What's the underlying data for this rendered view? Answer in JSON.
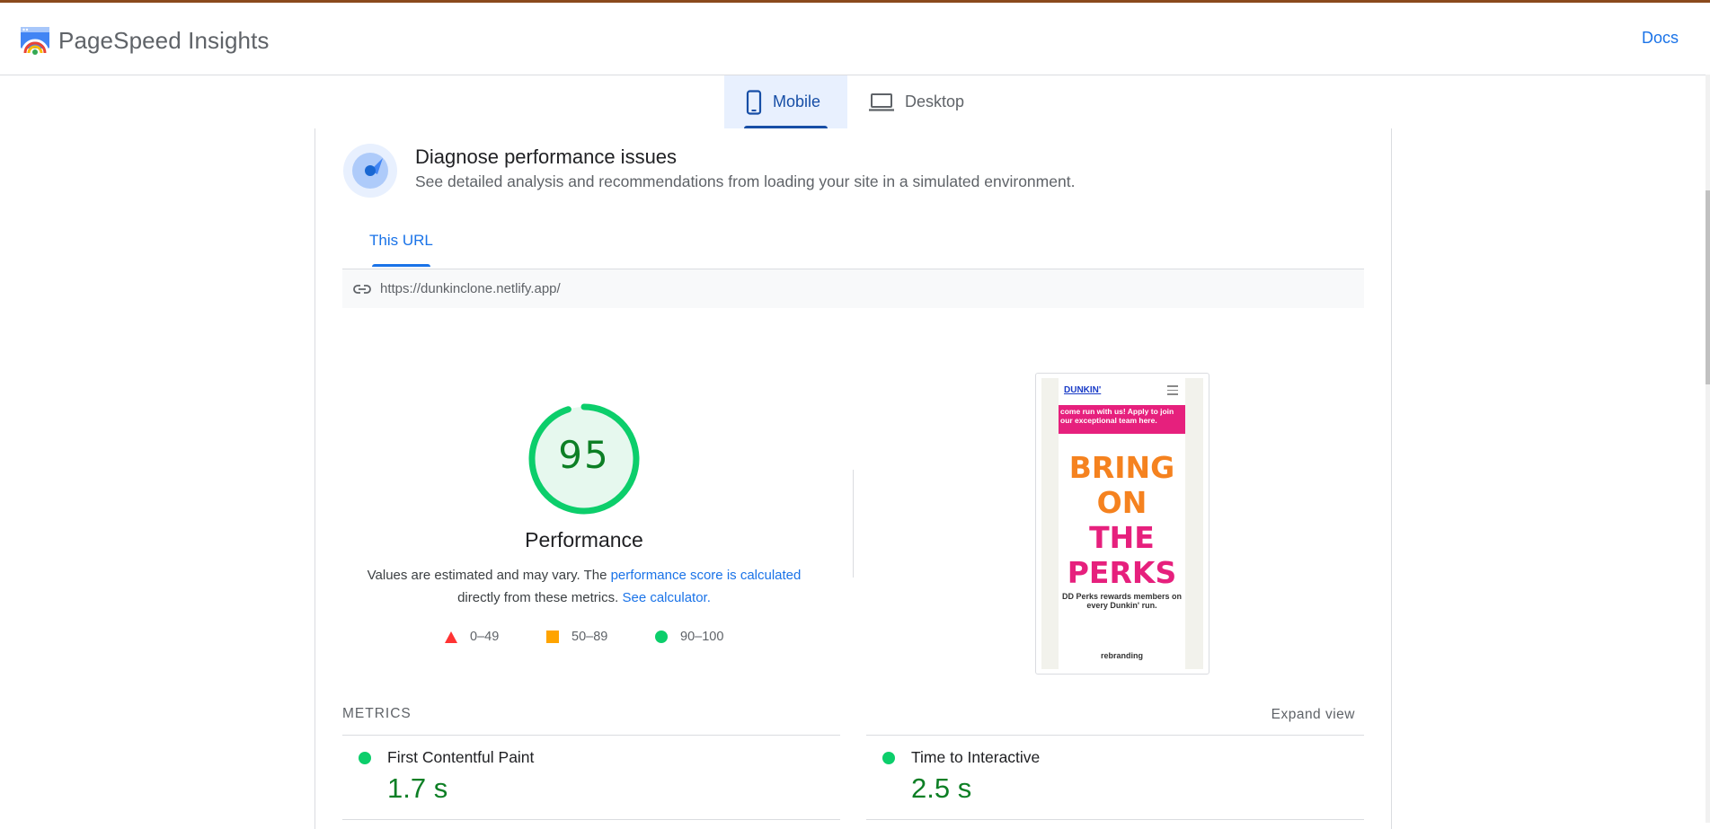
{
  "header": {
    "title": "PageSpeed Insights",
    "docs_label": "Docs"
  },
  "device_tabs": [
    {
      "label": "Mobile",
      "selected": true
    },
    {
      "label": "Desktop",
      "selected": false
    }
  ],
  "diagnose": {
    "title": "Diagnose performance issues",
    "subtitle": "See detailed analysis and recommendations from loading your site in a simulated environment."
  },
  "url_tab": {
    "label": "This URL",
    "url": "https://dunkinclone.netlify.app/"
  },
  "performance": {
    "score": "95",
    "score_value": 95,
    "label": "Performance",
    "desc_prefix": "Values are estimated and may vary. The ",
    "desc_link1": "performance score is calculated",
    "desc_middle": " directly from these metrics. ",
    "desc_link2": "See calculator.",
    "legend": [
      {
        "range": "0–49",
        "shape": "triangle",
        "color": "#ff3333"
      },
      {
        "range": "50–89",
        "shape": "square",
        "color": "#ffa400"
      },
      {
        "range": "90–100",
        "shape": "circle",
        "color": "#0cce6b"
      }
    ]
  },
  "screenshot": {
    "logo_alt": "DUNKIN'",
    "banner": "come run with us! Apply to join our exceptional team here.",
    "hero_lines": [
      "BRING",
      "ON",
      "THE",
      "PERKS"
    ],
    "sub": "DD Perks rewards members on every Dunkin' run.",
    "img_alt": "rebranding"
  },
  "metrics": {
    "label": "METRICS",
    "expand_label": "Expand view",
    "items": [
      {
        "name": "First Contentful Paint",
        "value": "1.7 s",
        "status": "good"
      },
      {
        "name": "Time to Interactive",
        "value": "2.5 s",
        "status": "good"
      }
    ]
  },
  "colors": {
    "accent": "#1a73e8",
    "good": "#0cce6b",
    "good_text": "#0d7f25"
  }
}
